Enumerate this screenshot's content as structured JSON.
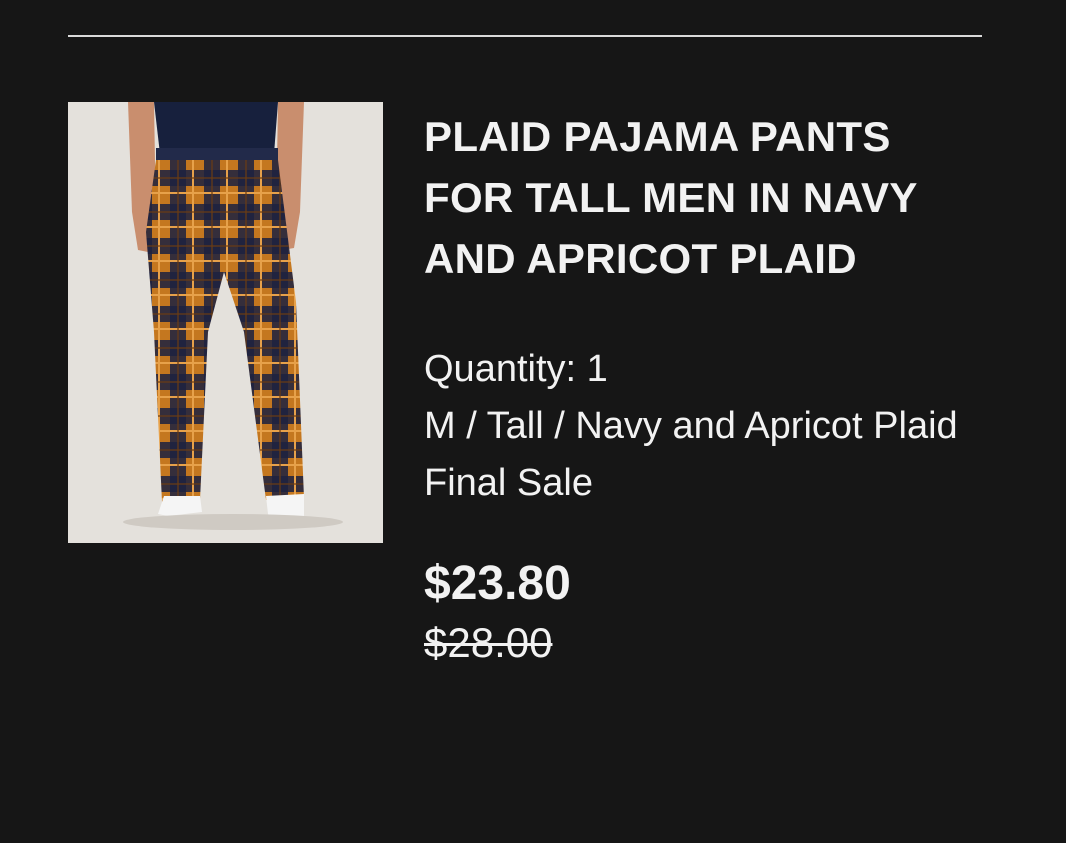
{
  "product": {
    "title": "PLAID PAJAMA PANTS FOR TALL MEN IN NAVY AND APRICOT PLAID",
    "quantity": "Quantity: 1",
    "variant": "M / Tall / Navy and Apricot Plaid",
    "sale_note": "Final Sale",
    "price": "$23.80",
    "compare_at_price": "$28.00",
    "image_icon": "product-photo-plaid-pants"
  },
  "colors": {
    "background": "#161616",
    "text": "#f2f2f2",
    "divider": "#d9d9d9",
    "plaid_navy": "#1c2140",
    "plaid_apricot": "#c4771f"
  }
}
